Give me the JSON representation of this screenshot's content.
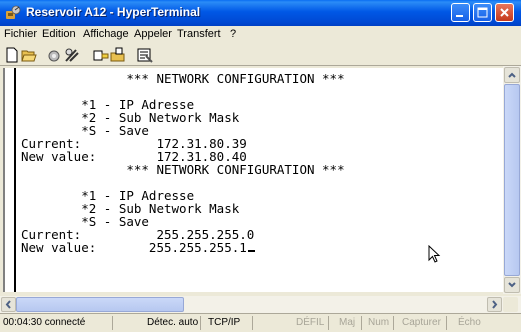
{
  "window": {
    "title": "Reservoir A12 - HyperTerminal"
  },
  "menu": {
    "items": [
      "Fichier",
      "Edition",
      "Affichage",
      "Appeler",
      "Transfert",
      "?"
    ]
  },
  "toolbar": {
    "icons": [
      "new-connection-icon",
      "open-icon",
      "connect-icon",
      "disconnect-icon",
      "send-icon",
      "receive-icon",
      "properties-icon"
    ]
  },
  "terminal": {
    "lines": [
      "              *** NETWORK CONFIGURATION ***",
      "",
      "        *1 - IP Adresse",
      "        *2 - Sub Network Mask",
      "        *S - Save",
      "Current:          172.31.80.39",
      "New value:        172.31.80.40",
      "              *** NETWORK CONFIGURATION ***",
      "",
      "        *1 - IP Adresse",
      "        *2 - Sub Network Mask",
      "        *S - Save",
      "Current:          255.255.255.0",
      "New value:       255.255.255.1"
    ]
  },
  "status": {
    "time": "00:04:30 connecté",
    "detect": "Détec. auto",
    "protocol": "TCP/IP",
    "defil": "DÉFIL",
    "maj": "Maj",
    "num": "Num",
    "capture": "Capturer",
    "echo": "Écho"
  }
}
